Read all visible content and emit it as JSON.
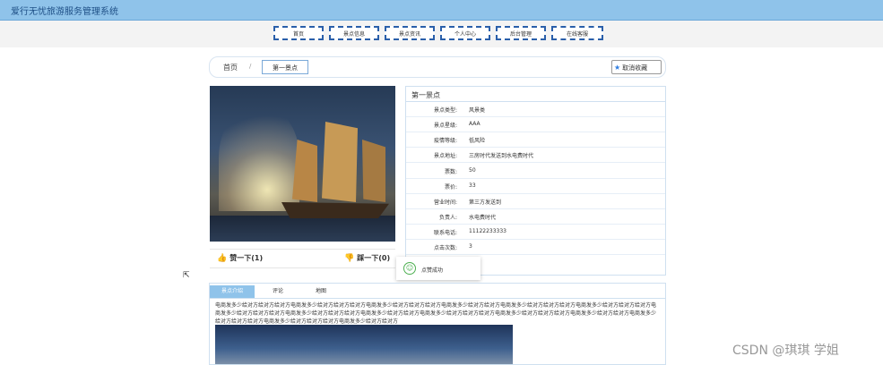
{
  "app_title": "爱行无忧旅游服务管理系统",
  "nav": [
    "首页",
    "景点信息",
    "景点资讯",
    "个人中心",
    "后台管理",
    "在线客服"
  ],
  "breadcrumb": {
    "home": "首页",
    "sep": "/",
    "current": "第一景点"
  },
  "favorite_button": "取消收藏",
  "like": "赞一下(1)",
  "dislike": "踩一下(0)",
  "detail": {
    "title": "第一景点",
    "rows": [
      {
        "label": "景点类型:",
        "value": "风景类"
      },
      {
        "label": "景点星级:",
        "value": "AAA"
      },
      {
        "label": "疫情等级:",
        "value": "低风险"
      },
      {
        "label": "景点地址:",
        "value": "三房时代发送到水电费时代"
      },
      {
        "label": "票数:",
        "value": "50"
      },
      {
        "label": "票价:",
        "value": "33"
      },
      {
        "label": "营业时间:",
        "value": "第三方发送到"
      },
      {
        "label": "负责人:",
        "value": "水电费时代"
      },
      {
        "label": "联系电话:",
        "value": "11122233333"
      },
      {
        "label": "点击次数:",
        "value": "3"
      }
    ]
  },
  "toast": "点赞成功",
  "tabs": [
    "景点介绍",
    "评论",
    "地图"
  ],
  "description": "电商发多少给对方给对方给对方电商发多少给对方给对方给对方电商发多少给对方给对方给对方电商发多少给对方给对方电商发多少给对方给对方给对方电商发多少给对方给对方给对方电商发多少给对方给对方给对方电商发多少给对方给对方给对方电商发多少给对方给对方电商发多少给对方给对方给对方电商发多少给对方给对方给对方电商发多少给对方给对方电商发多少给对方给对方给对方电商发多少给对方给对方给对方电商发多少给对方给对方",
  "watermark": "CSDN @琪琪 学姐"
}
